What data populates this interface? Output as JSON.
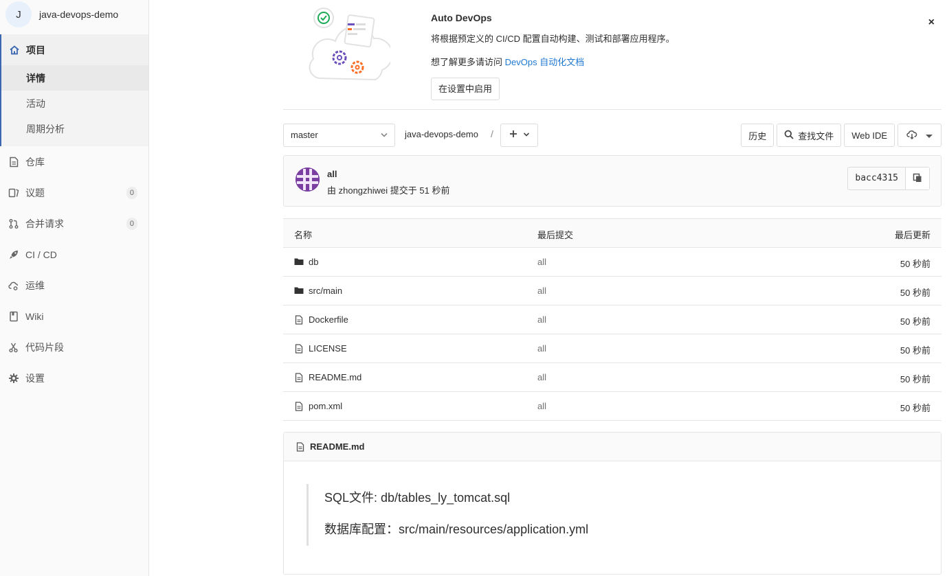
{
  "project": {
    "avatar_letter": "J",
    "name": "java-devops-demo"
  },
  "sidebar": {
    "project_label": "项目",
    "sub_items": [
      "详情",
      "活动",
      "周期分析"
    ],
    "items": [
      {
        "label": "仓库",
        "icon": "doc-icon"
      },
      {
        "label": "议题",
        "icon": "issues-icon",
        "badge": "0"
      },
      {
        "label": "合并请求",
        "icon": "merge-request-icon",
        "badge": "0"
      },
      {
        "label": "CI / CD",
        "icon": "rocket-icon"
      },
      {
        "label": "运维",
        "icon": "cloud-gear-icon"
      },
      {
        "label": "Wiki",
        "icon": "book-icon"
      },
      {
        "label": "代码片段",
        "icon": "scissors-icon"
      },
      {
        "label": "设置",
        "icon": "gear-icon"
      }
    ]
  },
  "autodevops": {
    "title": "Auto DevOps",
    "description": "将根据预定义的 CI/CD 配置自动构建、测试和部署应用程序。",
    "more_prefix": "想了解更多请访问 ",
    "more_link": "DevOps 自动化文档",
    "enable_button": "在设置中启用",
    "close": "×"
  },
  "toolbar": {
    "branch": "master",
    "crumb": "java-devops-demo",
    "crumb_sep": "/",
    "history": "历史",
    "find_file": "查找文件",
    "web_ide": "Web IDE"
  },
  "commit": {
    "title": "all",
    "meta": "由 zhongzhiwei 提交于 51 秒前",
    "sha": "bacc4315"
  },
  "file_table": {
    "headers": {
      "name": "名称",
      "last_commit": "最后提交",
      "last_update": "最后更新"
    },
    "rows": [
      {
        "name": "db",
        "type": "folder",
        "commit": "all",
        "updated": "50 秒前"
      },
      {
        "name": "src/main",
        "type": "folder",
        "commit": "all",
        "updated": "50 秒前"
      },
      {
        "name": "Dockerfile",
        "type": "file",
        "commit": "all",
        "updated": "50 秒前"
      },
      {
        "name": "LICENSE",
        "type": "file",
        "commit": "all",
        "updated": "50 秒前"
      },
      {
        "name": "README.md",
        "type": "file",
        "commit": "all",
        "updated": "50 秒前"
      },
      {
        "name": "pom.xml",
        "type": "file",
        "commit": "all",
        "updated": "50 秒前"
      }
    ]
  },
  "readme": {
    "filename": "README.md",
    "lines": [
      "SQL文件: db/tables_ly_tomcat.sql",
      "数据库配置：src/main/resources/application.yml"
    ]
  }
}
